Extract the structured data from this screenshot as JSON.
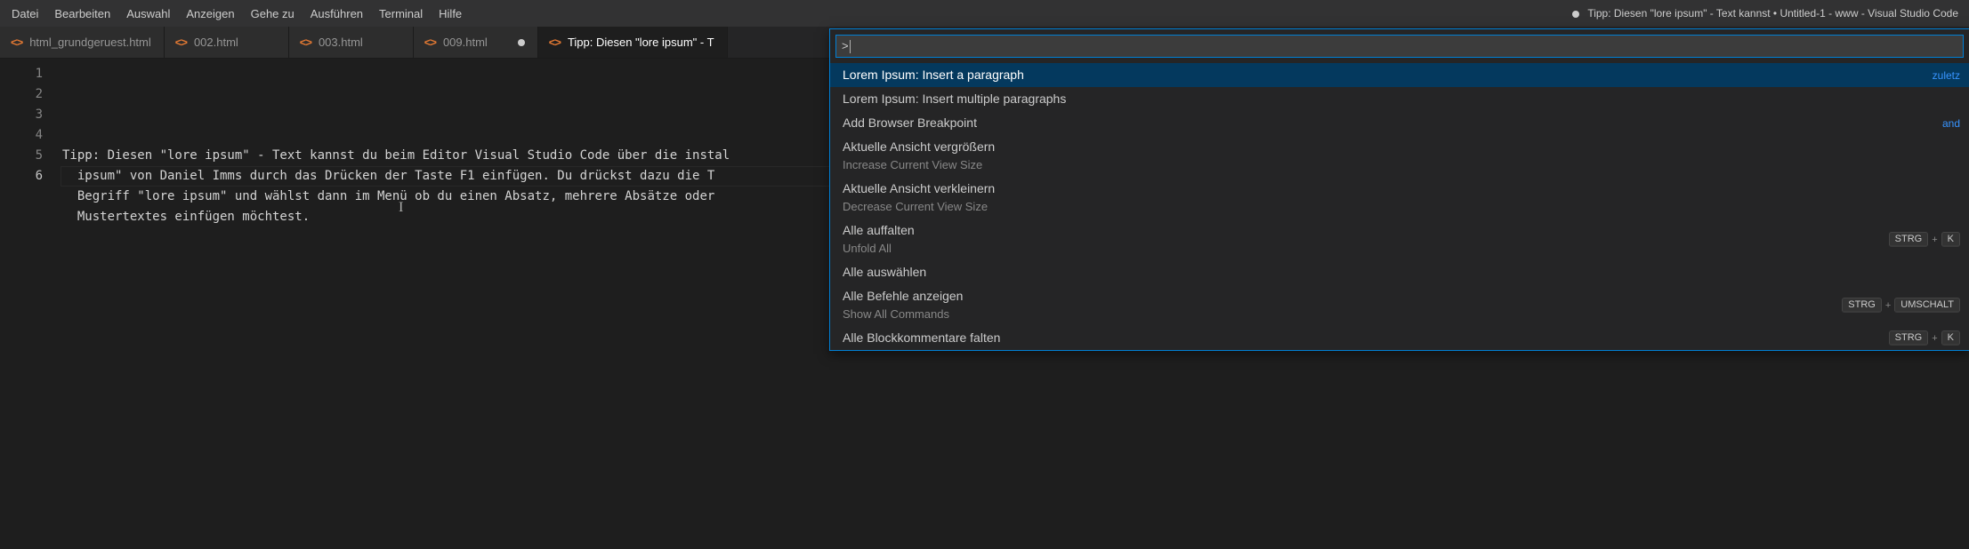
{
  "menubar": [
    "Datei",
    "Bearbeiten",
    "Auswahl",
    "Anzeigen",
    "Gehe zu",
    "Ausführen",
    "Terminal",
    "Hilfe"
  ],
  "window_title": "Tipp: Diesen \"lore ipsum\" - Text kannst • Untitled-1 - www - Visual Studio Code",
  "tabs": [
    {
      "label": "html_grundgeruest.html",
      "icon": "<>",
      "active": false,
      "dirty": false
    },
    {
      "label": "002.html",
      "icon": "<>",
      "active": false,
      "dirty": false
    },
    {
      "label": "003.html",
      "icon": "<>",
      "active": false,
      "dirty": false
    },
    {
      "label": "009.html",
      "icon": "<>",
      "active": false,
      "dirty": true
    },
    {
      "label": "Tipp: Diesen \"lore ipsum\" - T",
      "icon": "<>",
      "active": true,
      "dirty": false
    }
  ],
  "editor": {
    "line_numbers": [
      "1",
      "2",
      "3",
      "4",
      "5",
      "6"
    ],
    "current_line_index": 5,
    "lines": [
      "Tipp: Diesen \"lore ipsum\" - Text kannst du beim Editor Visual Studio Code über die instal",
      "  ipsum\" von Daniel Imms durch das Drücken der Taste F1 einfügen. Du drückst dazu die T",
      "  Begriff \"lore ipsum\" und wählst dann im Menü ob du einen Absatz, mehrere Absätze oder",
      "  Mustertextes einfügen möchtest.",
      "",
      ""
    ]
  },
  "palette": {
    "input_value": ">",
    "items": [
      {
        "main": "Lorem Ipsum: Insert a paragraph",
        "sub": "",
        "hint": "zuletz",
        "keys": [],
        "selected": true
      },
      {
        "main": "Lorem Ipsum: Insert multiple paragraphs",
        "sub": "",
        "hint": "",
        "keys": []
      },
      {
        "main": "Add Browser Breakpoint",
        "sub": "",
        "hint": "and",
        "keys": []
      },
      {
        "main": "Aktuelle Ansicht vergrößern",
        "sub": "Increase Current View Size",
        "hint": "",
        "keys": []
      },
      {
        "main": "Aktuelle Ansicht verkleinern",
        "sub": "Decrease Current View Size",
        "hint": "",
        "keys": []
      },
      {
        "main": "Alle auffalten",
        "sub": "Unfold All",
        "hint": "",
        "keys": [
          "STRG",
          "+",
          "K"
        ]
      },
      {
        "main": "Alle auswählen",
        "sub": "",
        "hint": "",
        "keys": []
      },
      {
        "main": "Alle Befehle anzeigen",
        "sub": "Show All Commands",
        "hint": "",
        "keys": [
          "STRG",
          "+",
          "UMSCHALT"
        ]
      },
      {
        "main": "Alle Blockkommentare falten",
        "sub": "",
        "hint": "",
        "keys": [
          "STRG",
          "+",
          "K"
        ]
      }
    ]
  }
}
